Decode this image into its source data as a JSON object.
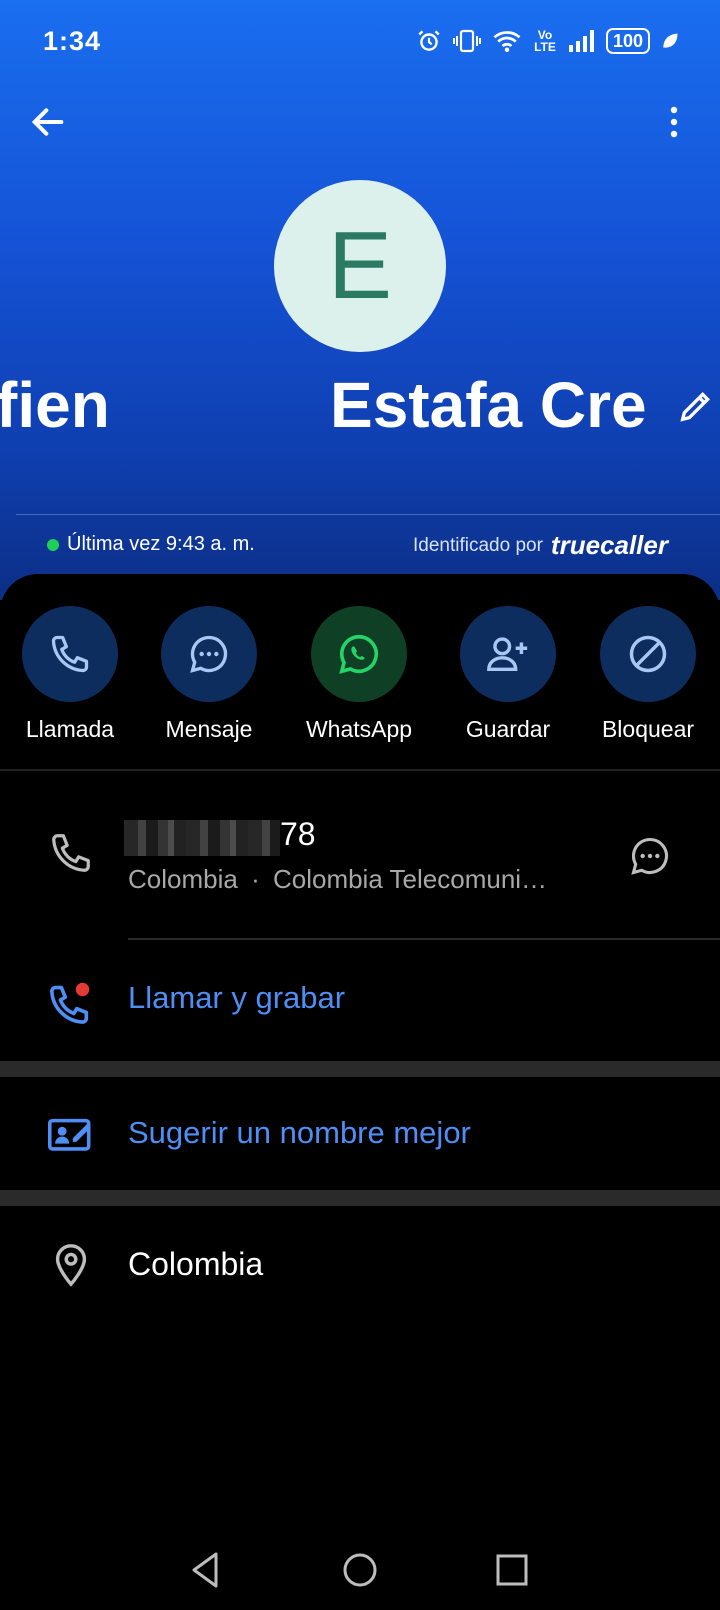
{
  "status_bar": {
    "time": "1:34",
    "network_label": "Vo LTE",
    "battery": "100"
  },
  "contact": {
    "avatar_letter": "E",
    "name_scroll_left": "fien",
    "name": "Estafa Cre",
    "last_seen": "Última vez 9:43 a. m.",
    "identified_by": "Identificado por",
    "brand": "truecaller"
  },
  "actions": [
    {
      "label": "Llamada",
      "icon": "phone-icon"
    },
    {
      "label": "Mensaje",
      "icon": "message-icon"
    },
    {
      "label": "WhatsApp",
      "icon": "whatsapp-icon"
    },
    {
      "label": "Guardar",
      "icon": "add-contact-icon"
    },
    {
      "label": "Bloquear",
      "icon": "block-icon"
    }
  ],
  "details": {
    "number_visible": "78",
    "country": "Colombia",
    "separator": "·",
    "carrier": "Colombia Telecomuni…",
    "call_record": "Llamar y grabar",
    "suggest_name": "Sugerir un nombre mejor",
    "location": "Colombia"
  },
  "colors": {
    "header_blue": "#1553d6",
    "link_blue": "#4e8ef5",
    "whatsapp_green": "#25d366",
    "online_green": "#1fcf5a",
    "record_red": "#e53935"
  }
}
